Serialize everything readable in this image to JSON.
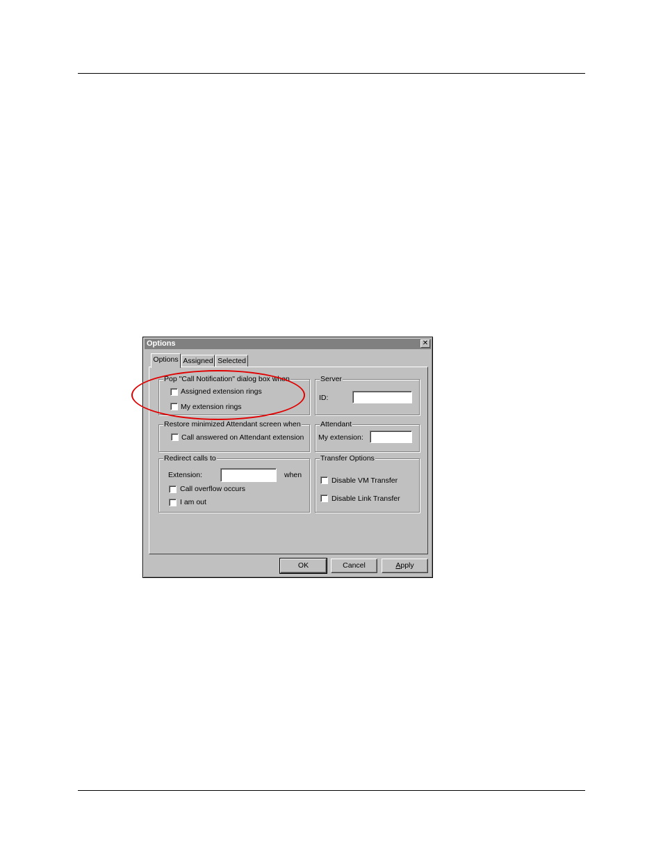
{
  "dialog": {
    "title": "Options",
    "close_glyph": "✕",
    "tabs": [
      {
        "label": "Options",
        "active": true
      },
      {
        "label": "Assigned",
        "active": false
      },
      {
        "label": "Selected",
        "active": false
      }
    ],
    "call_notification": {
      "legend": "Pop \"Call Notification\" dialog box when",
      "assigned_rings": {
        "label": "Assigned extension rings",
        "checked": false
      },
      "my_rings": {
        "label": "My extension rings",
        "checked": false
      }
    },
    "server": {
      "legend": "Server",
      "id_label": "ID:",
      "id_value": ""
    },
    "restore": {
      "legend": "Restore minimized Attendant screen when",
      "call_answered": {
        "label": "Call answered on Attendant extension",
        "checked": false
      }
    },
    "attendant": {
      "legend": "Attendant",
      "my_extension_label": "My extension:",
      "my_extension_value": ""
    },
    "redirect": {
      "legend": "Redirect calls to",
      "extension_label": "Extension:",
      "extension_value": "",
      "when_label": "when",
      "overflow": {
        "label": "Call overflow occurs",
        "checked": false
      },
      "out": {
        "label": "I am out",
        "checked": false
      }
    },
    "transfer": {
      "legend": "Transfer Options",
      "disable_vm": {
        "label": "Disable VM Transfer",
        "checked": false
      },
      "disable_link": {
        "label": "Disable Link Transfer",
        "checked": false
      }
    },
    "buttons": {
      "ok": "OK",
      "cancel": "Cancel",
      "apply_prefix": "A",
      "apply_rest": "pply"
    }
  },
  "annotation": {
    "color": "#e00000",
    "shape": "ellipse"
  }
}
